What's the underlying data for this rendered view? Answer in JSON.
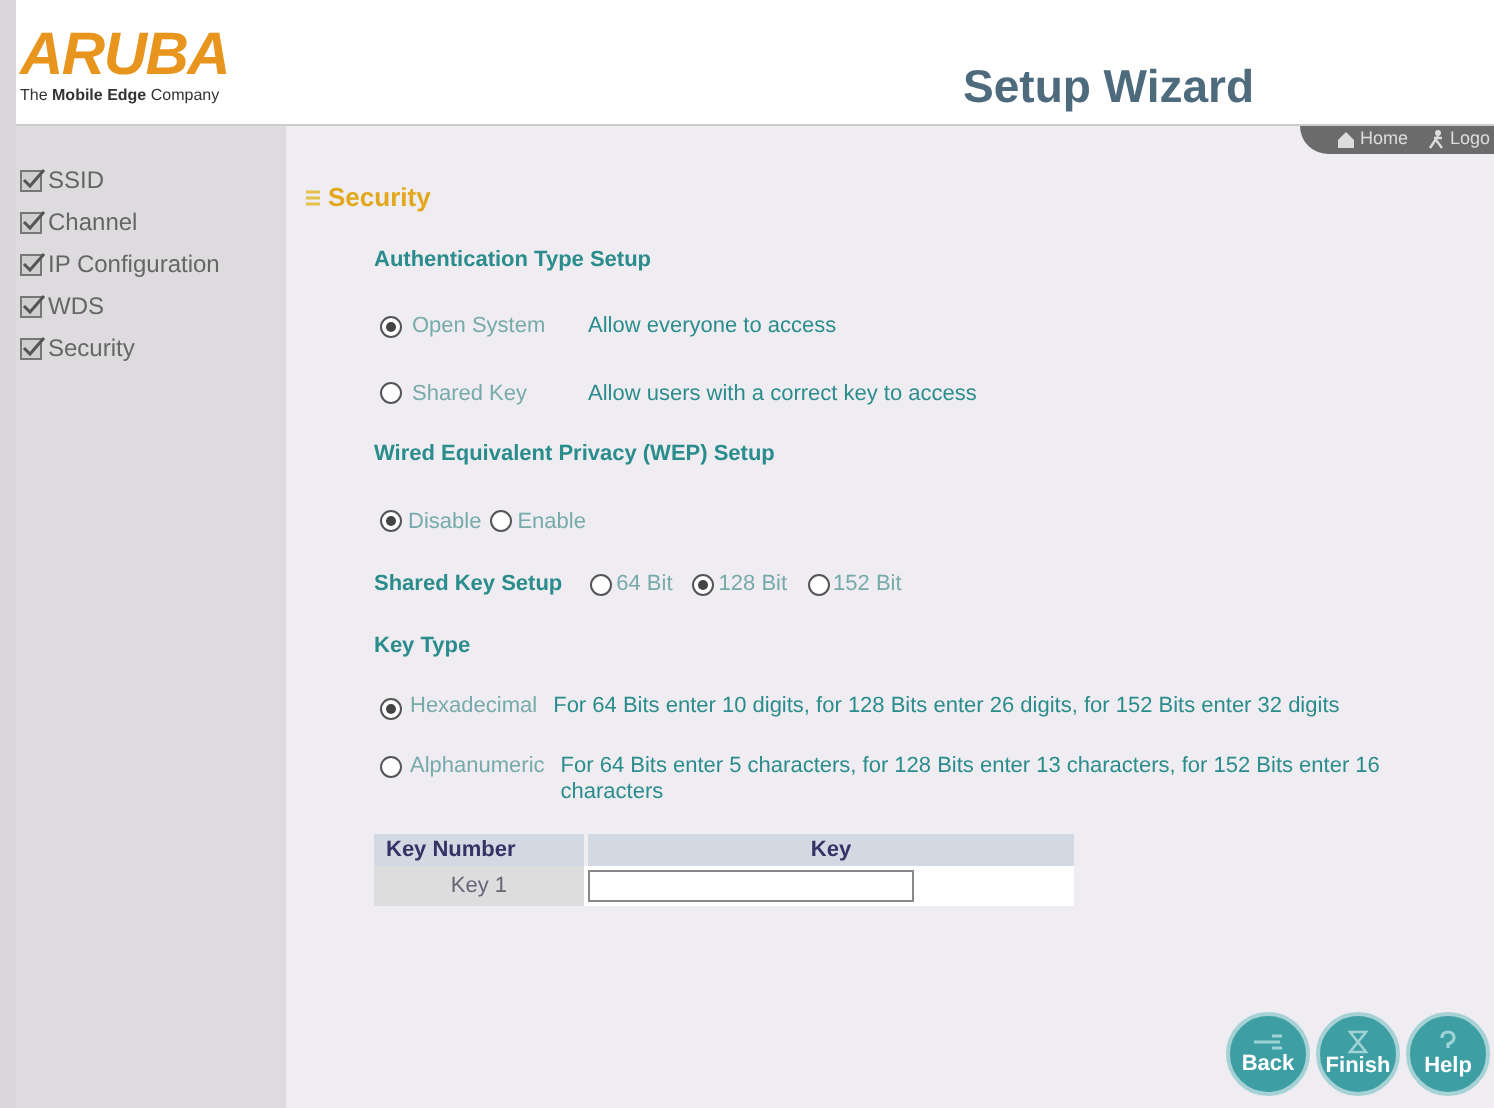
{
  "header": {
    "logo": "ARUBA",
    "tagline": "The **Mobile Edge** Company",
    "title": "Setup Wizard",
    "links": [
      {
        "label": "Home",
        "kind": "home"
      },
      {
        "label": "Logo",
        "kind": "logout"
      }
    ]
  },
  "sidebar": {
    "items": [
      {
        "label": "SSID",
        "checked": true
      },
      {
        "label": "Channel",
        "checked": true
      },
      {
        "label": "IP Configuration",
        "checked": true
      },
      {
        "label": "WDS",
        "checked": true
      },
      {
        "label": "Security",
        "checked": true
      }
    ]
  },
  "section": {
    "title": "Security"
  },
  "authentication": {
    "heading": "Authentication Type Setup",
    "options": [
      {
        "label": "Open System",
        "description": "Allow everyone to access",
        "selected": true
      },
      {
        "label": "Shared Key",
        "description": "Allow users with a correct key to access",
        "selected": false
      }
    ]
  },
  "wep": {
    "heading": "Wired Equivalent Privacy (WEP) Setup",
    "options": [
      {
        "label": "Disable",
        "selected": true
      },
      {
        "label": "Enable",
        "selected": false
      }
    ]
  },
  "shared_key": {
    "label": "Shared Key Setup",
    "options": [
      {
        "label": "64 Bit",
        "selected": false
      },
      {
        "label": "128 Bit",
        "selected": true
      },
      {
        "label": "152 Bit",
        "selected": false
      }
    ]
  },
  "key_type": {
    "heading": "Key Type",
    "options": [
      {
        "label": "Hexadecimal",
        "description": "For 64 Bits enter 10 digits, for 128 Bits enter 26 digits, for 152 Bits enter 32 digits",
        "selected": true
      },
      {
        "label": "Alphanumeric",
        "description": "For 64 Bits enter 5 characters, for 128 Bits enter 13 characters, for 152 Bits enter 16 characters",
        "selected": false
      }
    ]
  },
  "key_table": {
    "columns": [
      "Key Number",
      "Key"
    ],
    "rows": [
      {
        "label": "Key 1"
      }
    ]
  },
  "buttons": [
    {
      "label": "Back",
      "kind": "back"
    },
    {
      "label": "Finish",
      "kind": "finish"
    },
    {
      "label": "Help",
      "kind": "help"
    }
  ]
}
